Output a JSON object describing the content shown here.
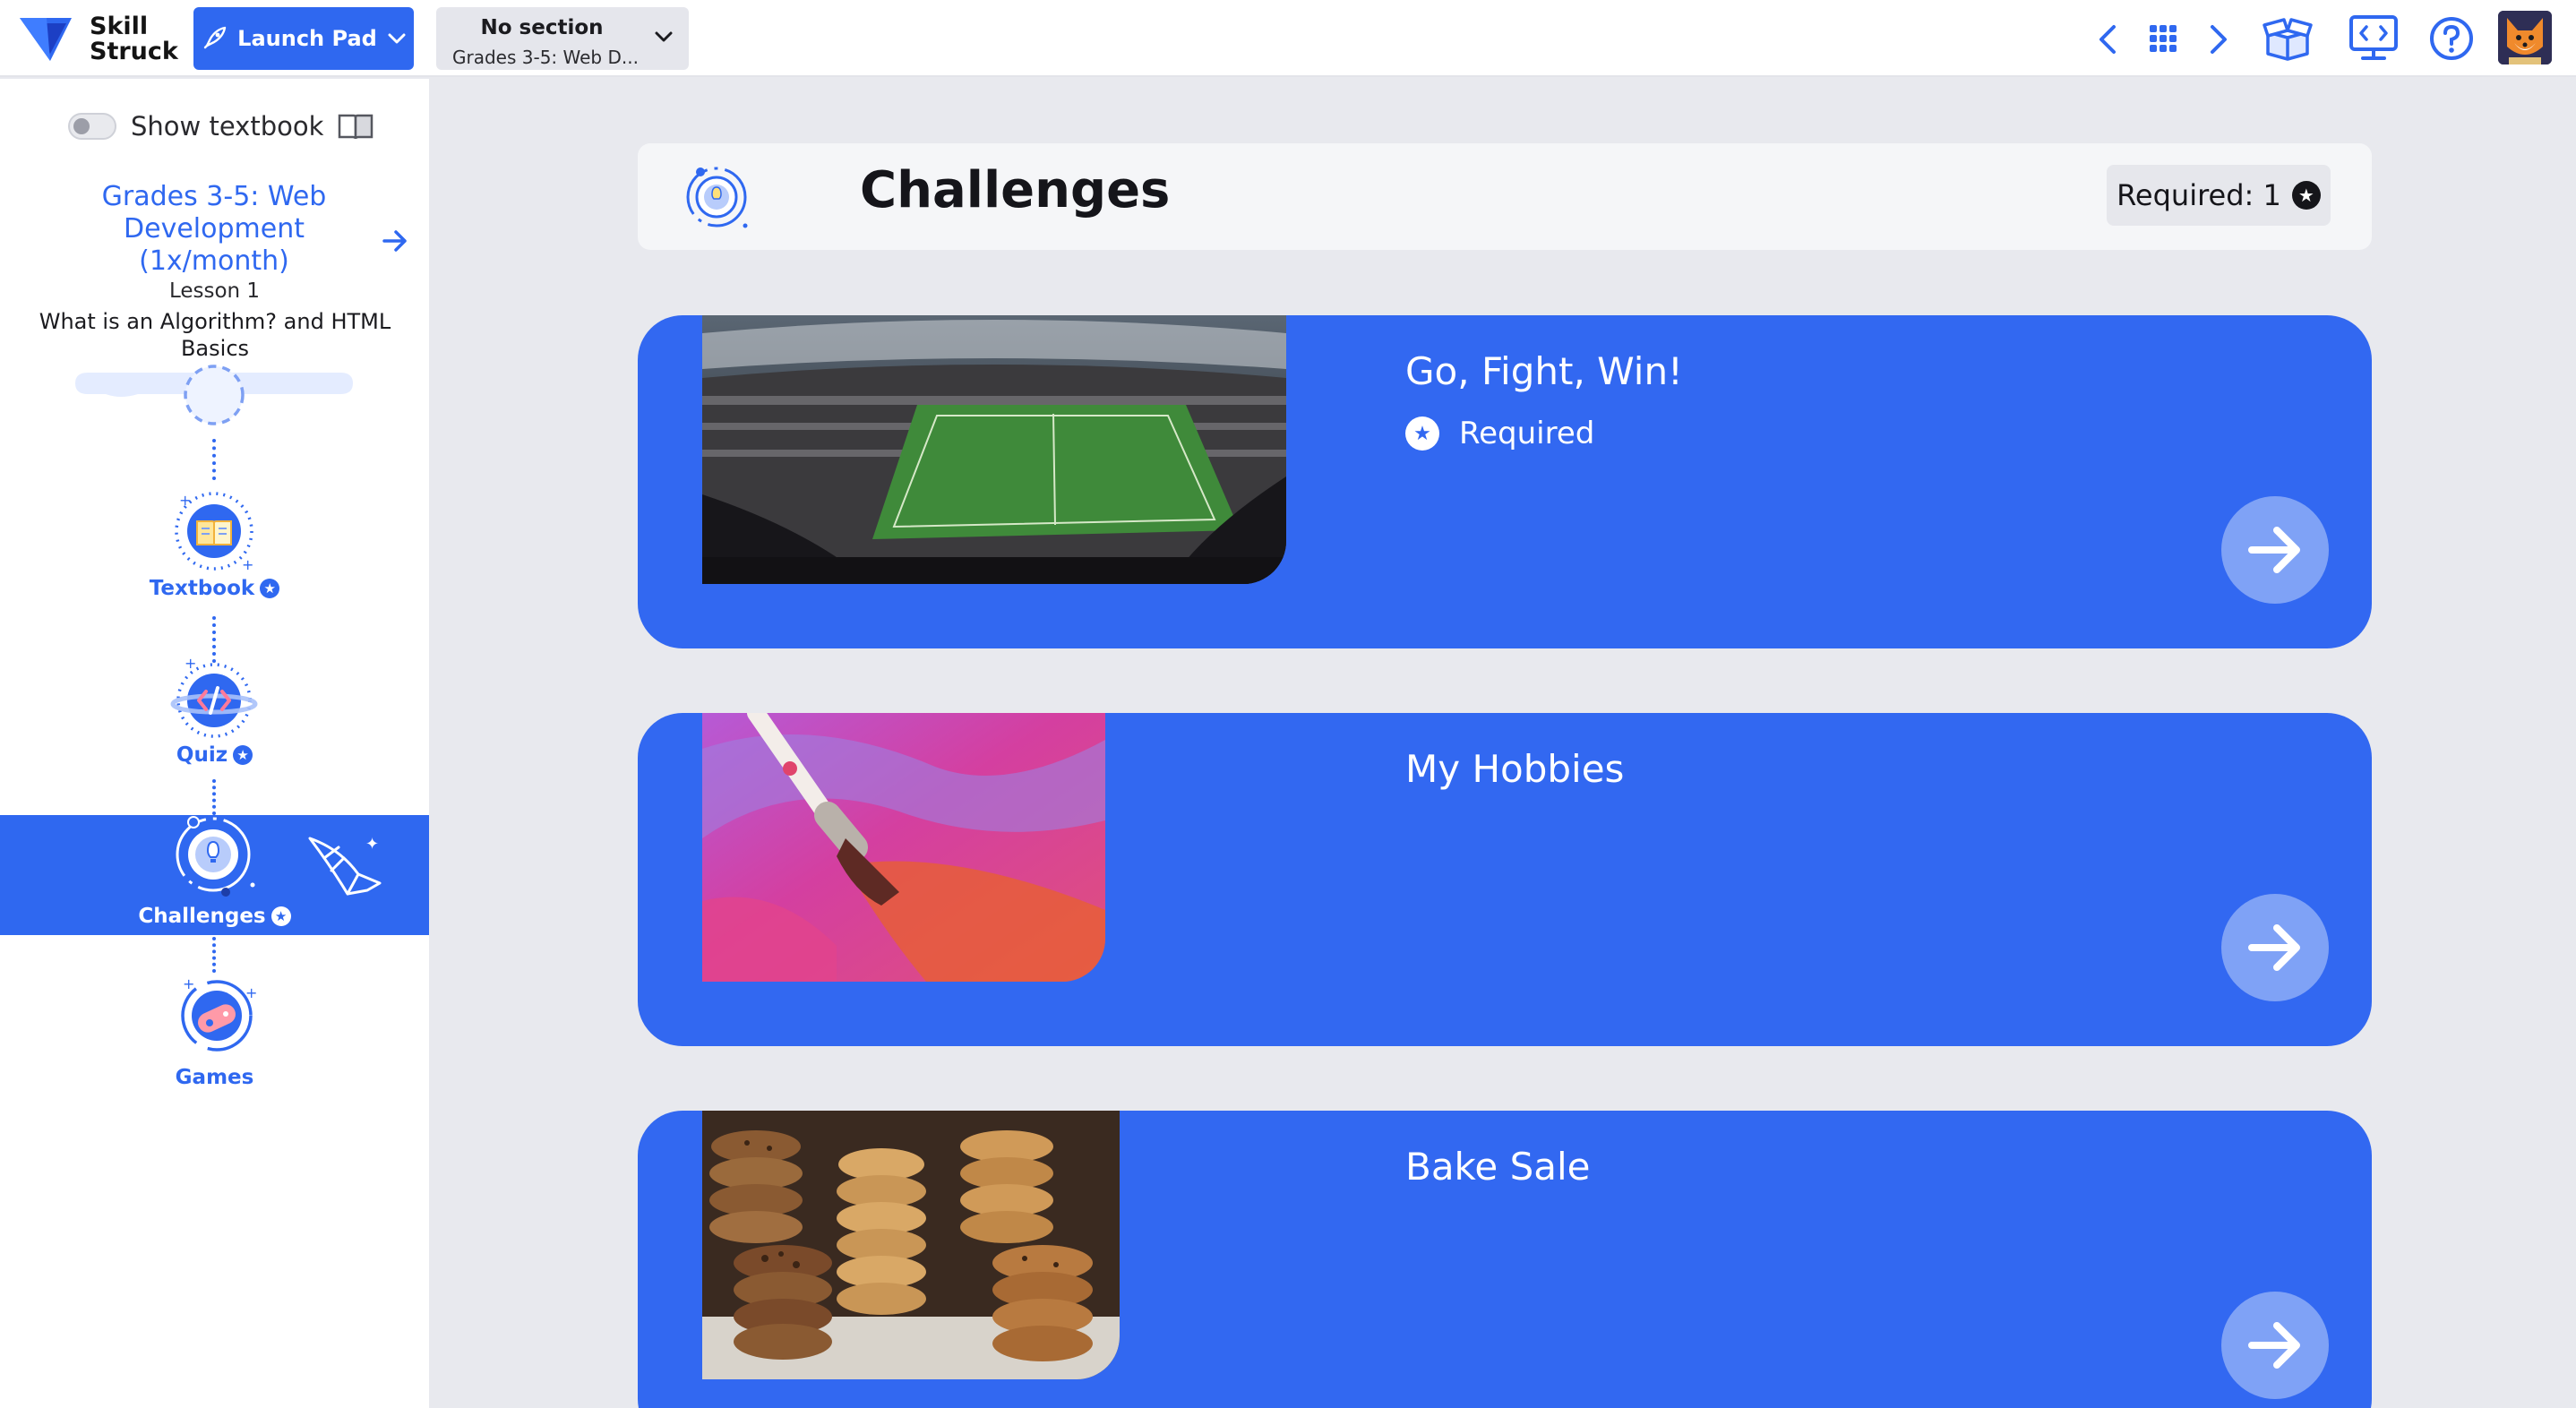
{
  "topbar": {
    "logo_line1": "Skill",
    "logo_line2": "Struck",
    "launch_label": "Launch Pad",
    "section_title": "No section",
    "section_subtitle": "Grades 3-5: Web D..."
  },
  "sidebar": {
    "toggle_label": "Show textbook",
    "course_title": "Grades 3-5: Web Development (1x/month)",
    "lesson_number": "Lesson 1",
    "lesson_name": "What is an Algorithm? and HTML Basics",
    "steps": [
      {
        "label": "Textbook"
      },
      {
        "label": "Quiz"
      },
      {
        "label": "Challenges"
      },
      {
        "label": "Games"
      }
    ]
  },
  "main": {
    "title": "Challenges",
    "required_label": "Required: 1",
    "cards": [
      {
        "title": "Go, Fight, Win!",
        "required_label": "Required"
      },
      {
        "title": "My Hobbies"
      },
      {
        "title": "Bake Sale"
      }
    ]
  },
  "colors": {
    "accent": "#2f68f0",
    "card": "#3268f1",
    "background": "#e8e9ee"
  }
}
